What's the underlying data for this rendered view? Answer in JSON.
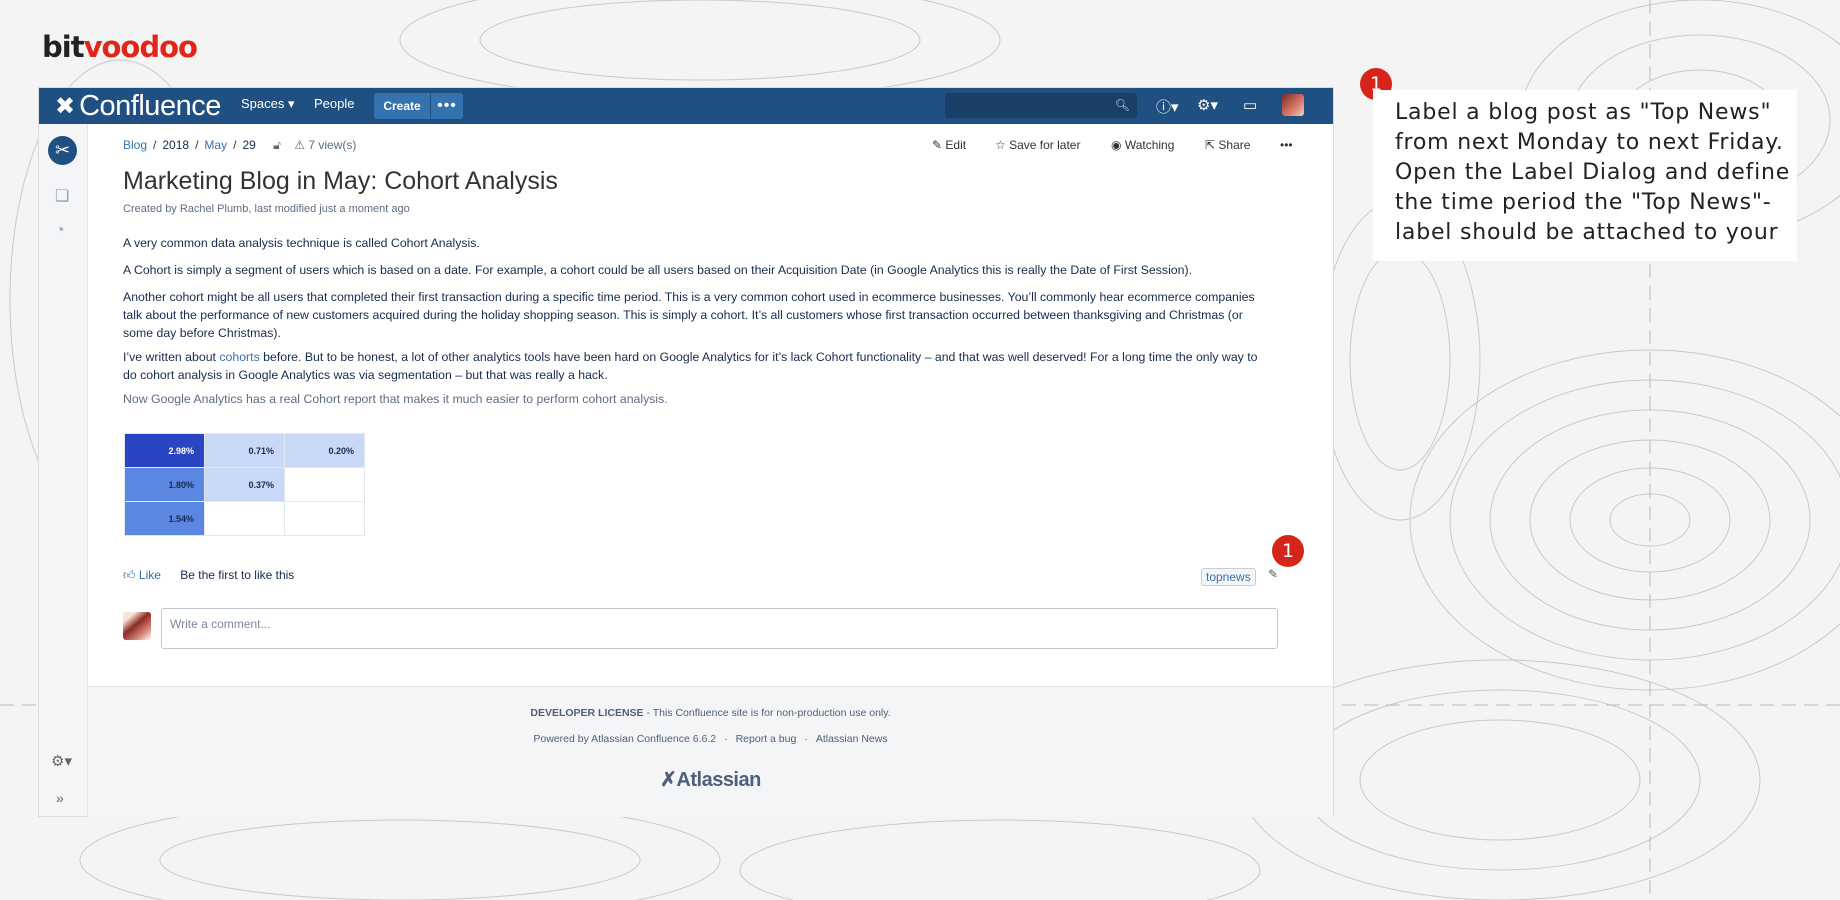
{
  "brand": {
    "part1": "bit",
    "part2": "voodoo"
  },
  "topbar": {
    "product": "Confluence",
    "spaces": "Spaces ▾",
    "people": "People",
    "create": "Create",
    "more": "•••",
    "search_placeholder": "",
    "icons": [
      "help-icon",
      "gear-icon",
      "notifications-icon",
      "user-avatar"
    ]
  },
  "breadcrumb": {
    "blog": "Blog",
    "year": "2018",
    "month": "May",
    "day": "29",
    "views": "7 view(s)"
  },
  "actions": {
    "edit": "Edit",
    "save": "Save for later",
    "watching": "Watching",
    "share": "Share",
    "more": "•••"
  },
  "page": {
    "title": "Marketing Blog in May: Cohort Analysis",
    "byline": "Created by Rachel Plumb, last modified just a moment ago",
    "p1": "A very common data analysis technique is called Cohort Analysis.",
    "p2": "A Cohort is simply a segment of users which is based on a date. For example, a cohort could be all users based on their Acquisition Date (in Google Analytics this is really the Date of First Session).",
    "p3": "Another cohort might be all users that completed their first transaction during a specific time period. This is a very common cohort used in ecommerce businesses. You’ll commonly hear ecommerce companies talk about the performance of new customers acquired during the holiday shopping season. This is simply a cohort. It’s all customers whose first transaction occurred between thanksgiving and Christmas (or some day before Christmas).",
    "p4_before": "I’ve written about ",
    "p4_link": "cohorts",
    "p4_after": " before. But to be honest, a lot of other analytics tools have been hard on Google Analytics for it’s lack Cohort functionality – and that was well deserved! For a long time the only way to do cohort analysis in Google Analytics was via segmentation – but that was really a hack.",
    "p5": "Now Google Analytics has a real Cohort report that makes it much easier to perform cohort analysis."
  },
  "cohort": {
    "rows": [
      [
        "2.98%",
        "0.71%",
        "0.20%"
      ],
      [
        "1.80%",
        "0.37%",
        ""
      ],
      [
        "1.54%",
        "",
        ""
      ]
    ],
    "colors": {
      "dark": "#2a45c2",
      "mid": "#5b87e3",
      "light": "#cad8f7",
      "empty": "#ffffff"
    }
  },
  "likes": {
    "like": "Like",
    "text": "Be the first to like this"
  },
  "label": {
    "name": "topnews"
  },
  "comment": {
    "placeholder": "Write a comment..."
  },
  "footer": {
    "license_bold": "DEVELOPER LICENSE",
    "license_rest": " - This Confluence site is for non-production use only.",
    "powered": "Powered by Atlassian Confluence 6.6.2",
    "bug": "Report a bug",
    "news": "Atlassian News",
    "logo": "Atlassian"
  },
  "tip": {
    "badge": "1",
    "text": "Label a blog post as \"Top News\" from next Monday to next Friday. Open the Label Dialog and define the time period the \"Top News\"-label should be attached to your"
  },
  "colors": {
    "header": "#205081",
    "accent": "#d6241b",
    "link": "#3572b0"
  }
}
